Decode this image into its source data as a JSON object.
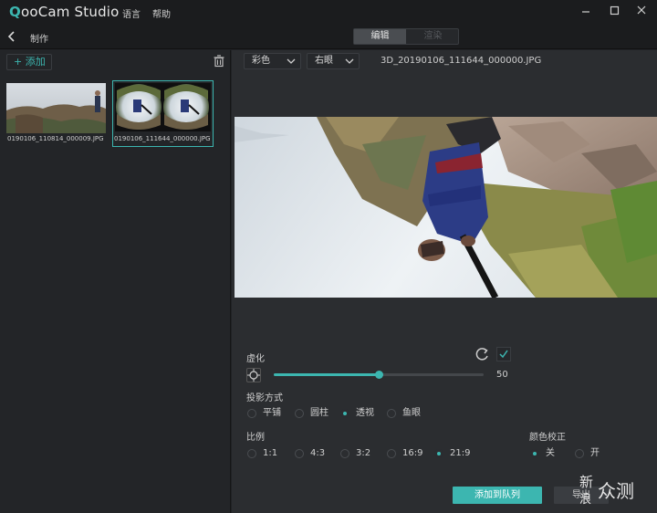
{
  "app": {
    "logo_q": "Q",
    "logo_rest": "ooCam Studio",
    "menu": [
      "语言",
      "帮助"
    ],
    "window_controls": [
      "minimize-icon",
      "maximize-icon",
      "close-icon"
    ]
  },
  "toolbar": {
    "page_title": "制作",
    "tabs": [
      {
        "label": "编辑",
        "active": true
      },
      {
        "label": "渲染",
        "active": false
      }
    ]
  },
  "library": {
    "add_label": "+ 添加",
    "items": [
      {
        "name": "0190106_110814_000009.JPG",
        "selected": false
      },
      {
        "name": "0190106_111644_000000.JPG",
        "selected": true
      }
    ]
  },
  "editor": {
    "color_mode": "彩色",
    "eye": "右眼",
    "filename": "3D_20190106_111644_000000.JPG",
    "blur": {
      "label": "虚化",
      "value": "50",
      "fraction": 0.5
    },
    "projection": {
      "label": "投影方式",
      "options": [
        "平铺",
        "圆柱",
        "透视",
        "鱼眼"
      ],
      "selected": 2
    },
    "ratio": {
      "label": "比例",
      "options": [
        "1:1",
        "4:3",
        "3:2",
        "16:9",
        "21:9"
      ],
      "selected": 4
    },
    "color_correction": {
      "label": "颜色校正",
      "options": [
        "关",
        "开"
      ],
      "selected": 0
    },
    "queue_label": "添加到队列",
    "export_label": "导出"
  },
  "watermark": {
    "line1": "新",
    "line2": "浪",
    "line3": "众测"
  },
  "colors": {
    "accent": "#3cb6b0",
    "panel": "#2b2d30",
    "sidebar": "#232528"
  }
}
